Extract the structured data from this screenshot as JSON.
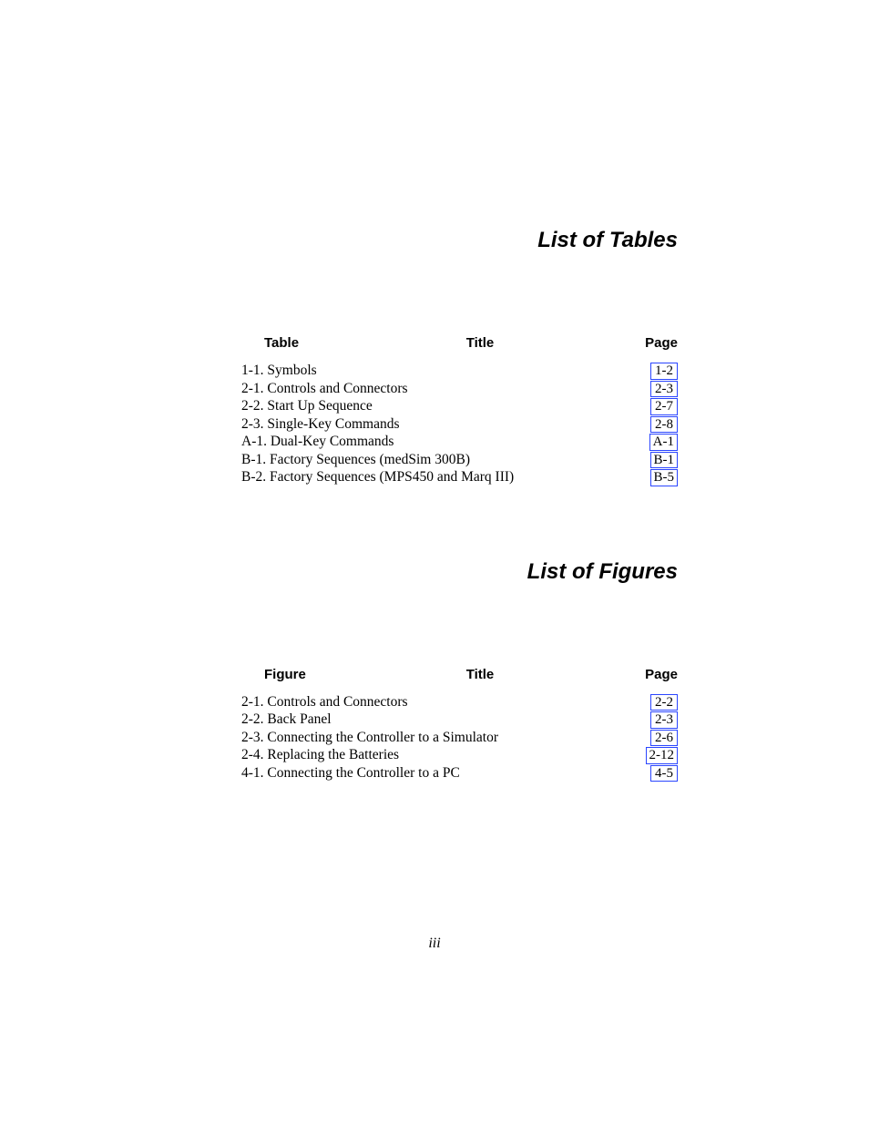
{
  "tables_section": {
    "heading": "List of Tables",
    "col_left": "Table",
    "col_center": "Title",
    "col_right": "Page",
    "entries": [
      {
        "num": "1-1.",
        "title": "Symbols",
        "page": "1-2"
      },
      {
        "num": "2-1.",
        "title": "Controls and Connectors",
        "page": "2-3"
      },
      {
        "num": "2-2.",
        "title": "Start Up Sequence",
        "page": "2-7"
      },
      {
        "num": "2-3.",
        "title": "Single-Key Commands",
        "page": "2-8"
      },
      {
        "num": "A-1.",
        "title": "Dual-Key Commands",
        "page": "A-1"
      },
      {
        "num": "B-1.",
        "title": "Factory Sequences (medSim 300B)",
        "page": "B-1"
      },
      {
        "num": "B-2.",
        "title": "Factory Sequences (MPS450 and Marq III)",
        "page": "B-5"
      }
    ]
  },
  "figures_section": {
    "heading": "List of Figures",
    "col_left": "Figure",
    "col_center": "Title",
    "col_right": "Page",
    "entries": [
      {
        "num": "2-1.",
        "title": "Controls and Connectors",
        "page": "2-2"
      },
      {
        "num": "2-2.",
        "title": "Back Panel",
        "page": "2-3"
      },
      {
        "num": "2-3.",
        "title": "Connecting the Controller to a Simulator",
        "page": "2-6"
      },
      {
        "num": "2-4.",
        "title": "Replacing the Batteries",
        "page": "2-12"
      },
      {
        "num": "4-1.",
        "title": "Connecting the Controller to a PC",
        "page": "4-5"
      }
    ]
  },
  "page_number": "iii"
}
